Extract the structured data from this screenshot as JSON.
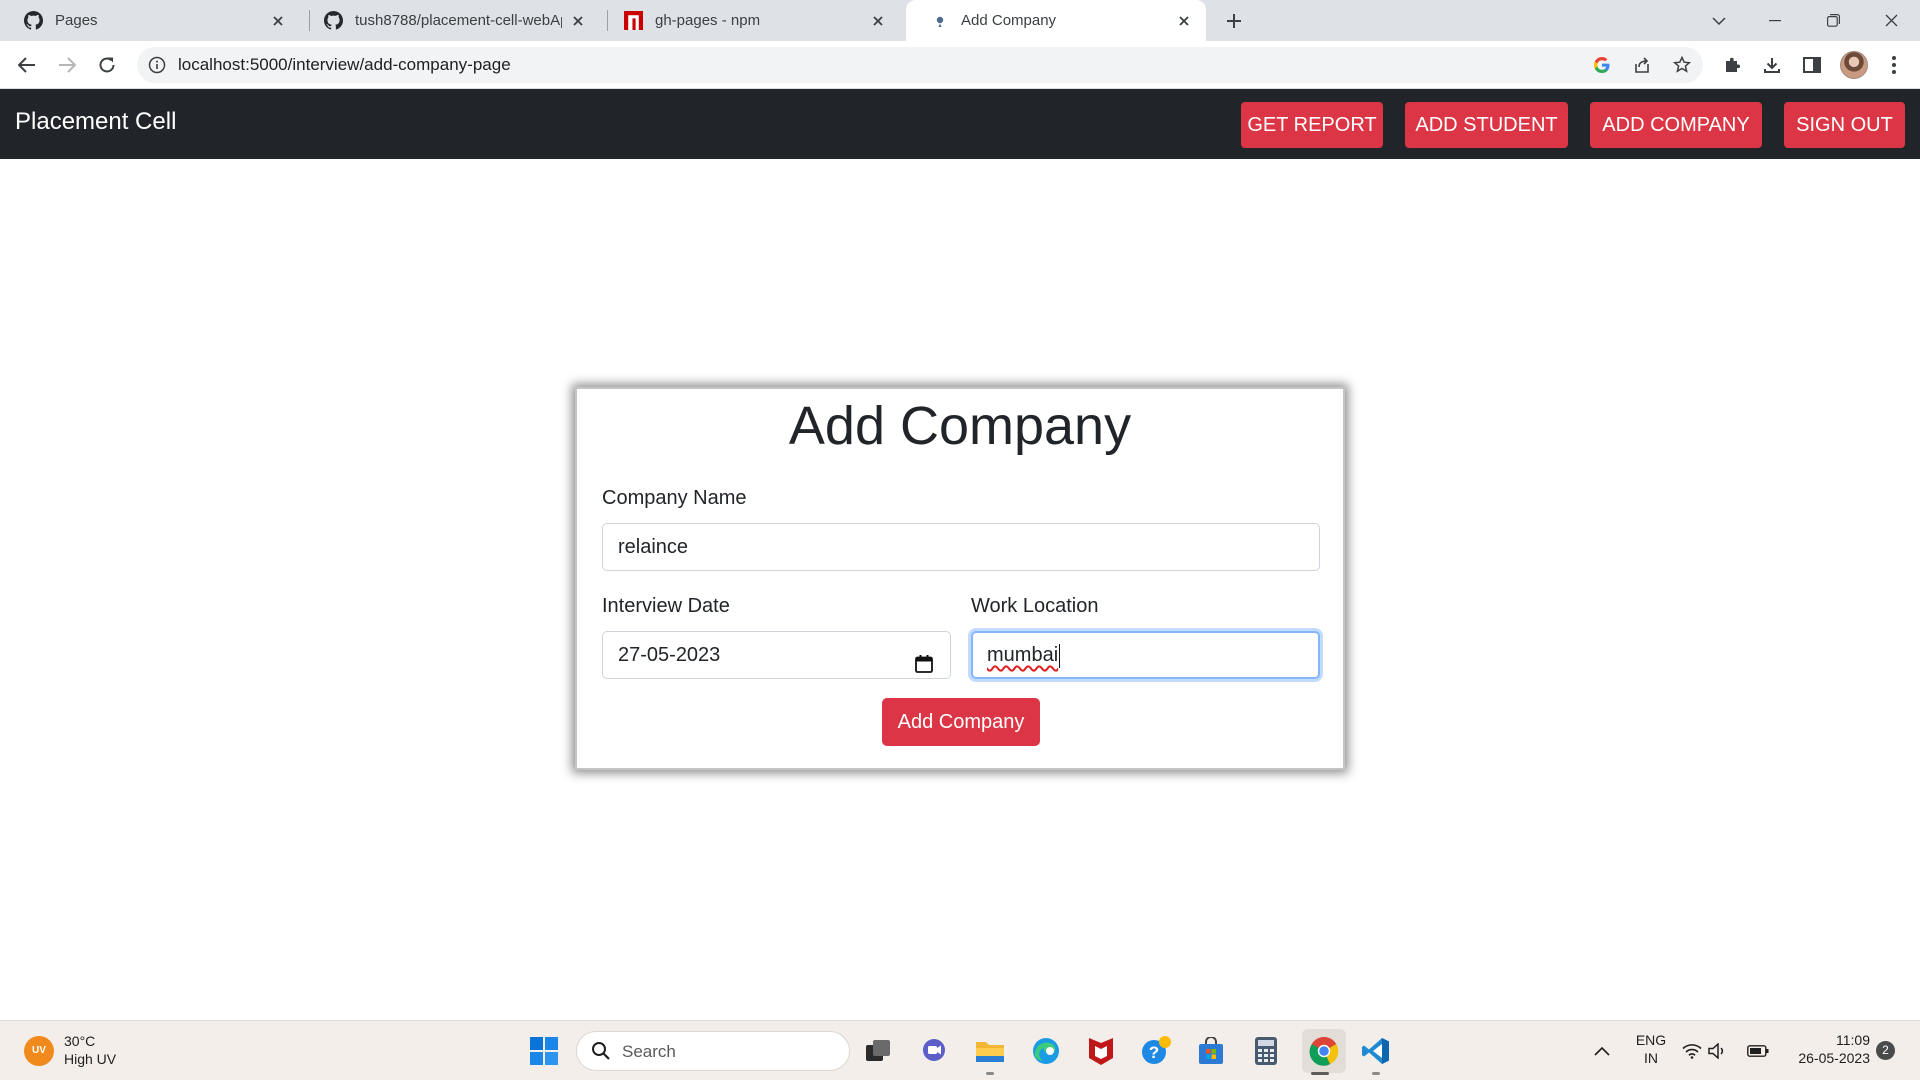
{
  "browser": {
    "tabs": [
      {
        "title": "Pages",
        "icon": "github-icon"
      },
      {
        "title": "tush8788/placement-cell-webApp",
        "icon": "github-icon"
      },
      {
        "title": "gh-pages - npm",
        "icon": "npm-icon"
      },
      {
        "title": "Add Company",
        "icon": "page-icon"
      }
    ],
    "url": "localhost:5000/interview/add-company-page"
  },
  "app": {
    "brand": "Placement Cell",
    "nav": {
      "get_report": "GET REPORT",
      "add_student": "ADD STUDENT",
      "add_company": "ADD COMPANY",
      "sign_out": "SIGN OUT"
    },
    "accent_color": "#dc3545",
    "navbar_color": "#212529"
  },
  "form": {
    "title": "Add Company",
    "company_name": {
      "label": "Company Name",
      "value": "relaince"
    },
    "interview_date": {
      "label": "Interview Date",
      "value": "27-05-2023"
    },
    "work_location": {
      "label": "Work Location",
      "value": "mumbai"
    },
    "submit_label": "Add Company"
  },
  "taskbar": {
    "weather": {
      "icon_text": "UV",
      "temp": "30°C",
      "condition": "High UV"
    },
    "search_label": "Search",
    "lang_top": "ENG",
    "lang_bottom": "IN",
    "time": "11:09",
    "date": "26-05-2023",
    "notifications": "2"
  }
}
